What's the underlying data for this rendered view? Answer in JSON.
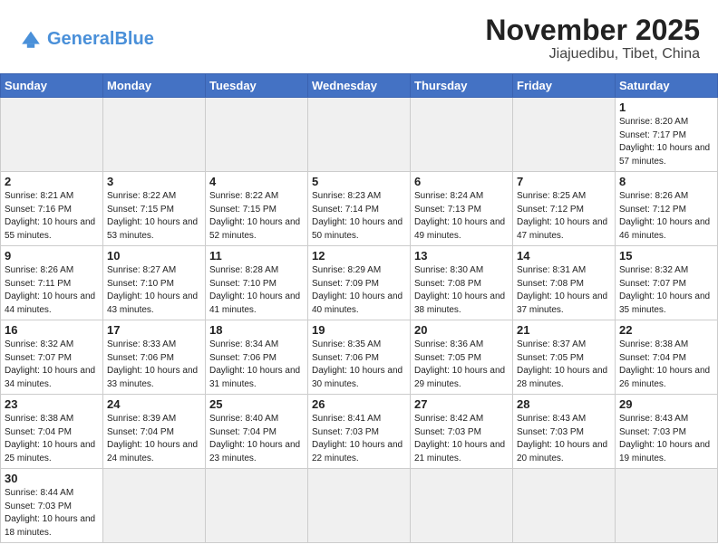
{
  "header": {
    "logo_general": "General",
    "logo_blue": "Blue",
    "month_title": "November 2025",
    "location": "Jiajuedibu, Tibet, China"
  },
  "days_of_week": [
    "Sunday",
    "Monday",
    "Tuesday",
    "Wednesday",
    "Thursday",
    "Friday",
    "Saturday"
  ],
  "weeks": [
    [
      {
        "day": "",
        "empty": true
      },
      {
        "day": "",
        "empty": true
      },
      {
        "day": "",
        "empty": true
      },
      {
        "day": "",
        "empty": true
      },
      {
        "day": "",
        "empty": true
      },
      {
        "day": "",
        "empty": true
      },
      {
        "day": "1",
        "sunrise": "8:20 AM",
        "sunset": "7:17 PM",
        "daylight": "10 hours and 57 minutes."
      }
    ],
    [
      {
        "day": "2",
        "sunrise": "8:21 AM",
        "sunset": "7:16 PM",
        "daylight": "10 hours and 55 minutes."
      },
      {
        "day": "3",
        "sunrise": "8:22 AM",
        "sunset": "7:15 PM",
        "daylight": "10 hours and 53 minutes."
      },
      {
        "day": "4",
        "sunrise": "8:22 AM",
        "sunset": "7:15 PM",
        "daylight": "10 hours and 52 minutes."
      },
      {
        "day": "5",
        "sunrise": "8:23 AM",
        "sunset": "7:14 PM",
        "daylight": "10 hours and 50 minutes."
      },
      {
        "day": "6",
        "sunrise": "8:24 AM",
        "sunset": "7:13 PM",
        "daylight": "10 hours and 49 minutes."
      },
      {
        "day": "7",
        "sunrise": "8:25 AM",
        "sunset": "7:12 PM",
        "daylight": "10 hours and 47 minutes."
      },
      {
        "day": "8",
        "sunrise": "8:26 AM",
        "sunset": "7:12 PM",
        "daylight": "10 hours and 46 minutes."
      }
    ],
    [
      {
        "day": "9",
        "sunrise": "8:26 AM",
        "sunset": "7:11 PM",
        "daylight": "10 hours and 44 minutes."
      },
      {
        "day": "10",
        "sunrise": "8:27 AM",
        "sunset": "7:10 PM",
        "daylight": "10 hours and 43 minutes."
      },
      {
        "day": "11",
        "sunrise": "8:28 AM",
        "sunset": "7:10 PM",
        "daylight": "10 hours and 41 minutes."
      },
      {
        "day": "12",
        "sunrise": "8:29 AM",
        "sunset": "7:09 PM",
        "daylight": "10 hours and 40 minutes."
      },
      {
        "day": "13",
        "sunrise": "8:30 AM",
        "sunset": "7:08 PM",
        "daylight": "10 hours and 38 minutes."
      },
      {
        "day": "14",
        "sunrise": "8:31 AM",
        "sunset": "7:08 PM",
        "daylight": "10 hours and 37 minutes."
      },
      {
        "day": "15",
        "sunrise": "8:32 AM",
        "sunset": "7:07 PM",
        "daylight": "10 hours and 35 minutes."
      }
    ],
    [
      {
        "day": "16",
        "sunrise": "8:32 AM",
        "sunset": "7:07 PM",
        "daylight": "10 hours and 34 minutes."
      },
      {
        "day": "17",
        "sunrise": "8:33 AM",
        "sunset": "7:06 PM",
        "daylight": "10 hours and 33 minutes."
      },
      {
        "day": "18",
        "sunrise": "8:34 AM",
        "sunset": "7:06 PM",
        "daylight": "10 hours and 31 minutes."
      },
      {
        "day": "19",
        "sunrise": "8:35 AM",
        "sunset": "7:06 PM",
        "daylight": "10 hours and 30 minutes."
      },
      {
        "day": "20",
        "sunrise": "8:36 AM",
        "sunset": "7:05 PM",
        "daylight": "10 hours and 29 minutes."
      },
      {
        "day": "21",
        "sunrise": "8:37 AM",
        "sunset": "7:05 PM",
        "daylight": "10 hours and 28 minutes."
      },
      {
        "day": "22",
        "sunrise": "8:38 AM",
        "sunset": "7:04 PM",
        "daylight": "10 hours and 26 minutes."
      }
    ],
    [
      {
        "day": "23",
        "sunrise": "8:38 AM",
        "sunset": "7:04 PM",
        "daylight": "10 hours and 25 minutes."
      },
      {
        "day": "24",
        "sunrise": "8:39 AM",
        "sunset": "7:04 PM",
        "daylight": "10 hours and 24 minutes."
      },
      {
        "day": "25",
        "sunrise": "8:40 AM",
        "sunset": "7:04 PM",
        "daylight": "10 hours and 23 minutes."
      },
      {
        "day": "26",
        "sunrise": "8:41 AM",
        "sunset": "7:03 PM",
        "daylight": "10 hours and 22 minutes."
      },
      {
        "day": "27",
        "sunrise": "8:42 AM",
        "sunset": "7:03 PM",
        "daylight": "10 hours and 21 minutes."
      },
      {
        "day": "28",
        "sunrise": "8:43 AM",
        "sunset": "7:03 PM",
        "daylight": "10 hours and 20 minutes."
      },
      {
        "day": "29",
        "sunrise": "8:43 AM",
        "sunset": "7:03 PM",
        "daylight": "10 hours and 19 minutes."
      }
    ],
    [
      {
        "day": "30",
        "sunrise": "8:44 AM",
        "sunset": "7:03 PM",
        "daylight": "10 hours and 18 minutes."
      },
      {
        "day": "",
        "empty": true
      },
      {
        "day": "",
        "empty": true
      },
      {
        "day": "",
        "empty": true
      },
      {
        "day": "",
        "empty": true
      },
      {
        "day": "",
        "empty": true
      },
      {
        "day": "",
        "empty": true
      }
    ]
  ]
}
